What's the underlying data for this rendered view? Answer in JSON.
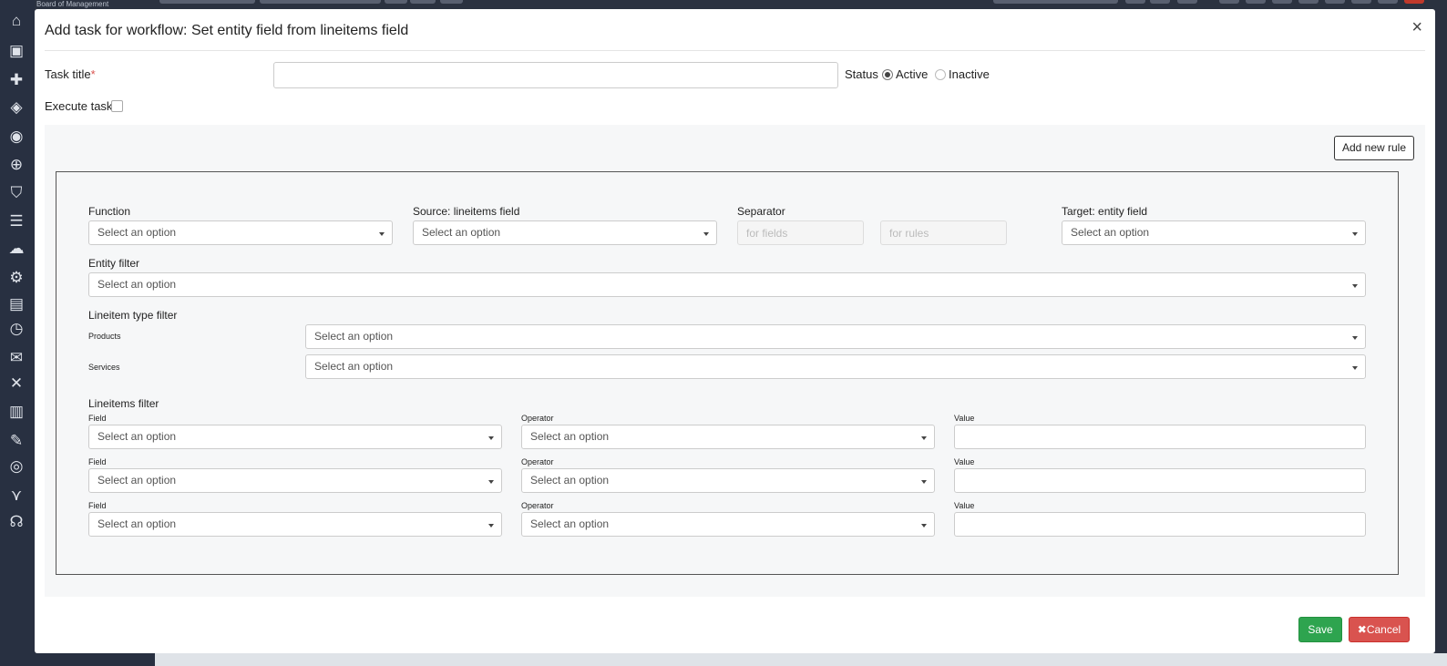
{
  "background": {
    "brand": "Board of Management",
    "sidebar_icons": [
      "home-icon",
      "briefcase-icon",
      "puzzle-icon",
      "cubes-icon",
      "palette-icon",
      "search-plus-icon",
      "shield-icon",
      "server-icon",
      "cloud-icon",
      "gear-icon",
      "table-icon",
      "clock-icon",
      "mail-icon",
      "tools-icon",
      "document-icon",
      "edit-document-icon",
      "lifebuoy-icon",
      "chart-icon",
      "headset-icon"
    ]
  },
  "modal": {
    "title": "Add task for workflow: Set entity field from lineitems field",
    "close": "×",
    "task_title_label": "Task title",
    "required_mark": "*",
    "status_label": "Status",
    "status_active": "Active",
    "status_inactive": "Inactive",
    "status_selected": "Active",
    "execute_task_label": "Execute task",
    "add_rule": "Add new rule",
    "rule": {
      "function_label": "Function",
      "source_label": "Source: lineitems field",
      "separator_label": "Separator",
      "target_label": "Target: entity field",
      "separator_fields_placeholder": "for fields",
      "separator_rules_placeholder": "for rules",
      "entity_filter_label": "Entity filter",
      "lineitem_type_filter_label": "Lineitem type filter",
      "products_label": "Products",
      "services_label": "Services",
      "lineitems_filter_label": "Lineitems filter",
      "field_label": "Field",
      "operator_label": "Operator",
      "value_label": "Value",
      "select_placeholder": "Select an option"
    },
    "save": "Save",
    "cancel": "Cancel",
    "cancel_icon": "✖"
  }
}
